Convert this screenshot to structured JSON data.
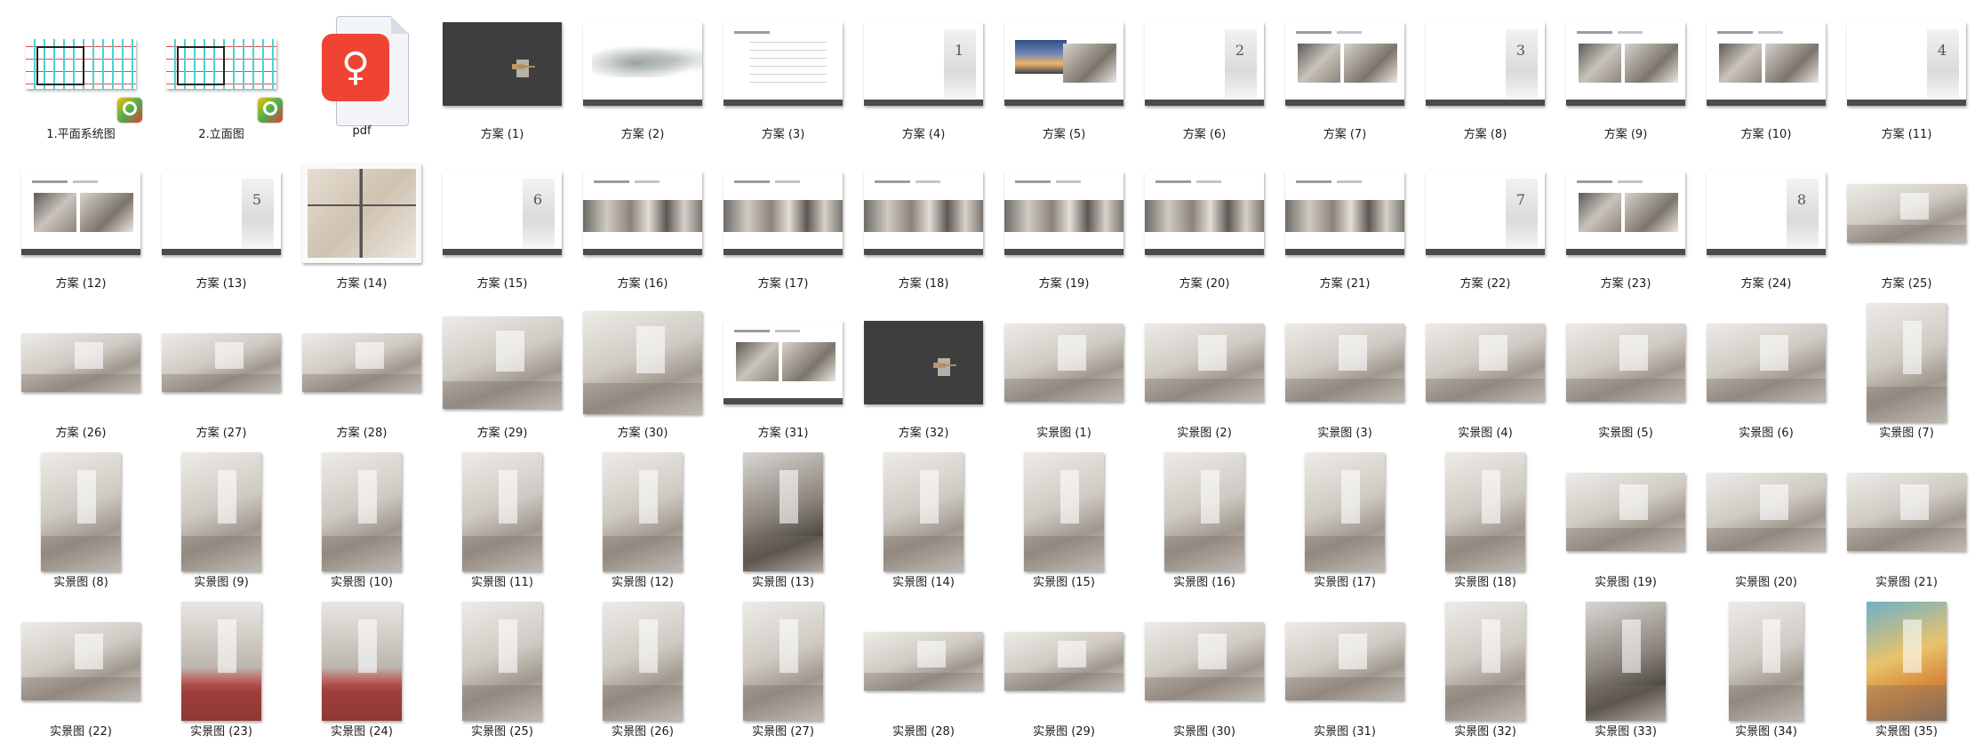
{
  "files": [
    {
      "label": "1.平面系统图",
      "kind": "cad",
      "app_icon": "dwg-app-icon"
    },
    {
      "label": "2.立面图",
      "kind": "cad",
      "app_icon": "dwg-app-icon"
    },
    {
      "label": "pdf",
      "kind": "folder-pdf",
      "app_icon": "pdf-app-icon"
    },
    {
      "label": "方案 (1)",
      "kind": "scheme-dark"
    },
    {
      "label": "方案 (2)",
      "kind": "scheme-mist"
    },
    {
      "label": "方案 (3)",
      "kind": "scheme-lines"
    },
    {
      "label": "方案 (4)",
      "kind": "scheme-num",
      "num": "1"
    },
    {
      "label": "方案 (5)",
      "kind": "scheme-city"
    },
    {
      "label": "方案 (6)",
      "kind": "scheme-num",
      "num": "2"
    },
    {
      "label": "方案 (7)",
      "kind": "scheme-photos"
    },
    {
      "label": "方案 (8)",
      "kind": "scheme-num",
      "num": "3"
    },
    {
      "label": "方案 (9)",
      "kind": "scheme-photos"
    },
    {
      "label": "方案 (10)",
      "kind": "scheme-photos"
    },
    {
      "label": "方案 (11)",
      "kind": "scheme-num",
      "num": "4"
    },
    {
      "label": "方案 (12)",
      "kind": "scheme-photos"
    },
    {
      "label": "方案 (13)",
      "kind": "scheme-num",
      "num": "5"
    },
    {
      "label": "方案 (14)",
      "kind": "floorplan"
    },
    {
      "label": "方案 (15)",
      "kind": "scheme-num",
      "num": "6"
    },
    {
      "label": "方案 (16)",
      "kind": "scheme-strip"
    },
    {
      "label": "方案 (17)",
      "kind": "scheme-strip"
    },
    {
      "label": "方案 (18)",
      "kind": "scheme-strip"
    },
    {
      "label": "方案 (19)",
      "kind": "scheme-strip"
    },
    {
      "label": "方案 (20)",
      "kind": "scheme-strip"
    },
    {
      "label": "方案 (21)",
      "kind": "scheme-strip"
    },
    {
      "label": "方案 (22)",
      "kind": "scheme-num",
      "num": "7"
    },
    {
      "label": "方案 (23)",
      "kind": "scheme-photos"
    },
    {
      "label": "方案 (24)",
      "kind": "scheme-num",
      "num": "8"
    },
    {
      "label": "方案 (25)",
      "kind": "render-wide"
    },
    {
      "label": "方案 (26)",
      "kind": "render-wide"
    },
    {
      "label": "方案 (27)",
      "kind": "render-wide"
    },
    {
      "label": "方案 (28)",
      "kind": "render-wide"
    },
    {
      "label": "方案 (29)",
      "kind": "render"
    },
    {
      "label": "方案 (30)",
      "kind": "render-tall"
    },
    {
      "label": "方案 (31)",
      "kind": "scheme-photos"
    },
    {
      "label": "方案 (32)",
      "kind": "scheme-dark"
    },
    {
      "label": "实景图 (1)",
      "kind": "photo"
    },
    {
      "label": "实景图 (2)",
      "kind": "photo"
    },
    {
      "label": "实景图 (3)",
      "kind": "photo"
    },
    {
      "label": "实景图 (4)",
      "kind": "photo"
    },
    {
      "label": "实景图 (5)",
      "kind": "photo"
    },
    {
      "label": "实景图 (6)",
      "kind": "photo"
    },
    {
      "label": "实景图 (7)",
      "kind": "photo-tall"
    },
    {
      "label": "实景图 (8)",
      "kind": "photo-portrait"
    },
    {
      "label": "实景图 (9)",
      "kind": "photo-portrait"
    },
    {
      "label": "实景图 (10)",
      "kind": "photo-portrait"
    },
    {
      "label": "实景图 (11)",
      "kind": "photo-portrait"
    },
    {
      "label": "实景图 (12)",
      "kind": "photo-portrait"
    },
    {
      "label": "实景图 (13)",
      "kind": "photo-portrait-dark"
    },
    {
      "label": "实景图 (14)",
      "kind": "photo-portrait"
    },
    {
      "label": "实景图 (15)",
      "kind": "photo-portrait"
    },
    {
      "label": "实景图 (16)",
      "kind": "photo-portrait"
    },
    {
      "label": "实景图 (17)",
      "kind": "photo-portrait"
    },
    {
      "label": "实景图 (18)",
      "kind": "photo-portrait"
    },
    {
      "label": "实景图 (19)",
      "kind": "photo"
    },
    {
      "label": "实景图 (20)",
      "kind": "photo"
    },
    {
      "label": "实景图 (21)",
      "kind": "photo"
    },
    {
      "label": "实景图 (22)",
      "kind": "photo"
    },
    {
      "label": "实景图 (23)",
      "kind": "photo-portrait-red"
    },
    {
      "label": "实景图 (24)",
      "kind": "photo-portrait-red"
    },
    {
      "label": "实景图 (25)",
      "kind": "photo-portrait"
    },
    {
      "label": "实景图 (26)",
      "kind": "photo-portrait"
    },
    {
      "label": "实景图 (27)",
      "kind": "photo-portrait"
    },
    {
      "label": "实景图 (28)",
      "kind": "photo-low"
    },
    {
      "label": "实景图 (29)",
      "kind": "photo-low"
    },
    {
      "label": "实景图 (30)",
      "kind": "photo"
    },
    {
      "label": "实景图 (31)",
      "kind": "photo"
    },
    {
      "label": "实景图 (32)",
      "kind": "photo-portrait"
    },
    {
      "label": "实景图 (33)",
      "kind": "photo-portrait-dark"
    },
    {
      "label": "实景图 (34)",
      "kind": "photo-portrait-narrow"
    },
    {
      "label": "实景图 (35)",
      "kind": "photo-portrait-glow"
    }
  ],
  "colors": {
    "label_text": "#1a1a1a",
    "scheme_bar": "#4b4b4b",
    "pdf_red": "#ef4433",
    "cad_cyan": "#1fc7c7"
  }
}
